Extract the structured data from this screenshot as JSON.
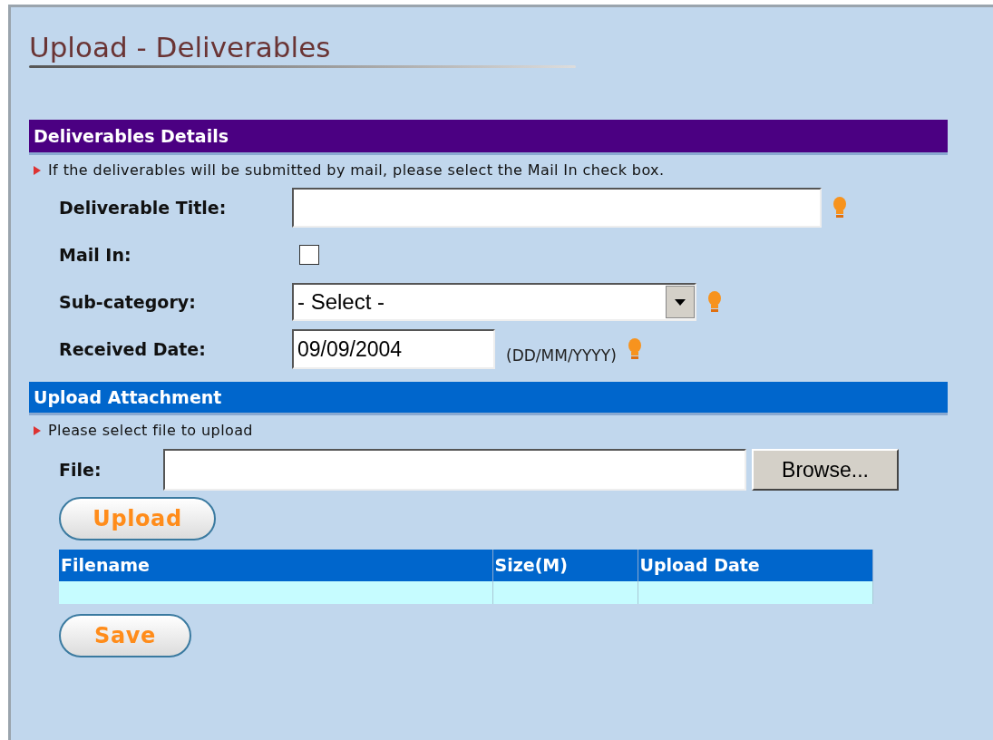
{
  "title": "Upload - Deliverables",
  "details": {
    "header": "Deliverables Details",
    "hint": "If the deliverables will be submitted by mail, please select the Mail In check box.",
    "fields": [
      {
        "kind": "text",
        "label": "Deliverable Title:",
        "help_icon": true
      },
      {
        "kind": "checkbox",
        "label": "Mail In:",
        "checked": false,
        "help_icon": false
      },
      {
        "kind": "select",
        "label": "Sub-category:",
        "value": "- Select -",
        "help_icon": true
      },
      {
        "kind": "date",
        "label": "Received Date:",
        "value": "09/09/2004",
        "format": "(DD/MM/YYYY)",
        "help_icon": true
      }
    ]
  },
  "attachment": {
    "header": "Upload Attachment",
    "hint": "Please select file to upload",
    "file_label": "File:",
    "browse": "Browse...",
    "upload": "Upload",
    "table": {
      "columns": [
        "Filename",
        "Size(M)",
        "Upload Date"
      ]
    }
  },
  "save": "Save"
}
